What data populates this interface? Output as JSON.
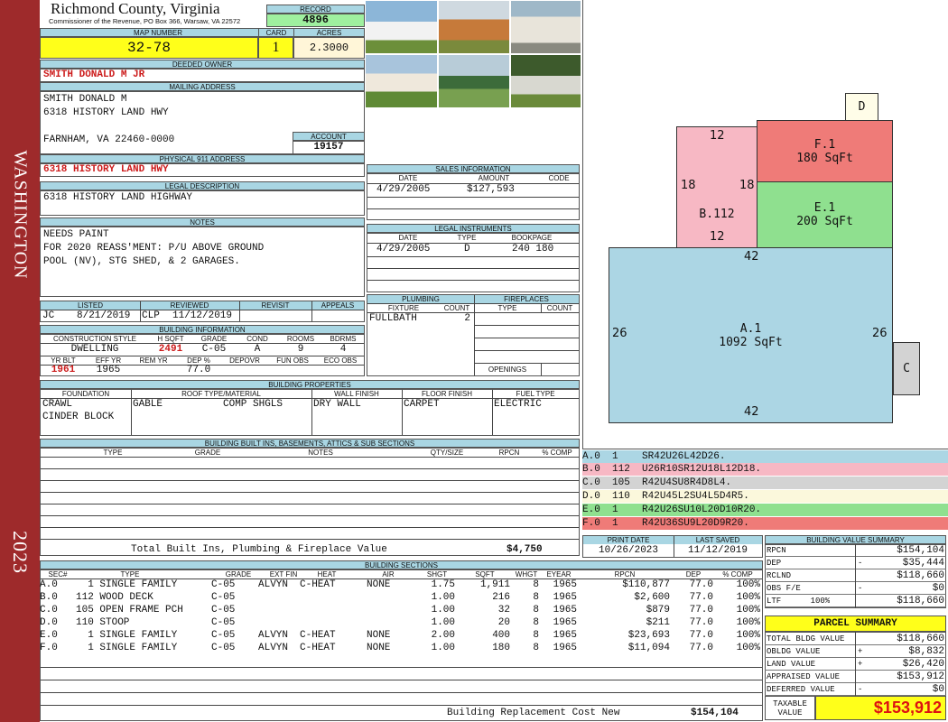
{
  "sidebar": {
    "county": "WASHINGTON",
    "year": "2023"
  },
  "header": {
    "title": "Richmond County, Virginia",
    "subtitle": "Commissioner of the Revenue, PO Box 366, Warsaw, VA 22572",
    "record_label": "RECORD",
    "record": "4896",
    "map_label": "MAP NUMBER",
    "map": "32-78",
    "card_label": "CARD",
    "card": "1",
    "acres_label": "ACRES",
    "acres": "2.3000"
  },
  "owner": {
    "label": "DEEDED OWNER",
    "name": "SMITH DONALD M JR",
    "mail_label": "MAILING ADDRESS",
    "mail1": "SMITH DONALD M",
    "mail2": "6318 HISTORY LAND HWY",
    "mail3": "FARNHAM, VA 22460-0000",
    "account_label": "ACCOUNT",
    "account": "19157",
    "phys_label": "PHYSICAL 911 ADDRESS",
    "phys": "6318 HISTORY LAND HWY",
    "legal_label": "LEGAL DESCRIPTION",
    "legal": "6318 HISTORY LAND HIGHWAY"
  },
  "notes": {
    "label": "NOTES",
    "lines": [
      "NEEDS PAINT",
      "FOR 2020 REASS'MENT: P/U ABOVE GROUND",
      "POOL (NV), STG SHED, & 2 GARAGES."
    ]
  },
  "sales": {
    "label": "SALES INFORMATION",
    "h_date": "DATE",
    "h_amount": "AMOUNT",
    "h_code": "CODE",
    "date": "4/29/2005",
    "amount": "$127,593",
    "code": ""
  },
  "legal_instr": {
    "label": "LEGAL INSTRUMENTS",
    "h_date": "DATE",
    "h_type": "TYPE",
    "h_book": "BOOKPAGE",
    "date": "4/29/2005",
    "type": "D",
    "book": "240 180"
  },
  "review": {
    "h_listed": "LISTED",
    "h_reviewed": "REVIEWED",
    "h_revisit": "REVISIT",
    "h_appeals": "APPEALS",
    "listed_by": "JC",
    "listed": "8/21/2019",
    "reviewed_by": "CLP",
    "reviewed": "11/12/2019"
  },
  "building": {
    "label": "BUILDING INFORMATION",
    "h_style": "CONSTRUCTION STYLE",
    "h_hsqft": "H SQFT",
    "h_grade": "GRADE",
    "h_cond": "COND",
    "h_rooms": "ROOMS",
    "h_bdrms": "BDRMS",
    "style": "DWELLING",
    "hsqft": "2491",
    "grade": "C-05",
    "cond": "A",
    "rooms": "9",
    "bdrms": "4",
    "h_yrblt": "YR BLT",
    "h_effyr": "EFF YR",
    "h_remyr": "REM YR",
    "h_dep": "DEP %",
    "h_depovr": "DEPOVR",
    "h_funobs": "FUN OBS",
    "h_ecoobs": "ECO OBS",
    "yrblt": "1961",
    "effyr": "1965",
    "dep": "77.0"
  },
  "plumbing": {
    "label": "PLUMBING",
    "h_fixture": "FIXTURE",
    "h_count": "COUNT",
    "fixture": "FULLBATH",
    "count": "2"
  },
  "fireplaces": {
    "label": "FIREPLACES",
    "h_type": "TYPE",
    "h_count": "COUNT",
    "openings": "OPENINGS"
  },
  "properties": {
    "label": "BUILDING PROPERTIES",
    "h_found": "FOUNDATION",
    "h_roof": "ROOF TYPE/MATERIAL",
    "h_wall": "WALL FINISH",
    "h_floor": "FLOOR FINISH",
    "h_fuel": "FUEL TYPE",
    "found1": "CRAWL",
    "found2": "CINDER BLOCK",
    "roof1": "GABLE",
    "roof2": "COMP SHGLS",
    "wall": "DRY WALL",
    "floor": "CARPET",
    "fuel": "ELECTRIC"
  },
  "builtins": {
    "label": "BUILDING BUILT INS, BASEMENTS, ATTICS & SUB SECTIONS",
    "h_type": "TYPE",
    "h_grade": "GRADE",
    "h_notes": "NOTES",
    "h_qty": "QTY/SIZE",
    "h_rpcn": "RPCN",
    "h_comp": "% COMP",
    "total_label": "Total Built Ins, Plumbing & Fireplace Value",
    "total": "$4,750"
  },
  "dates": {
    "h_print": "PRINT DATE",
    "h_saved": "LAST SAVED",
    "print": "10/26/2023",
    "saved": "11/12/2019"
  },
  "sketch": {
    "D": "D",
    "C": "C",
    "F_label": "F.1",
    "F_area": "180 SqFt",
    "E_label": "E.1",
    "E_area": "200 SqFt",
    "B_label": "B.112",
    "A_label": "A.1",
    "A_area": "1092 SqFt",
    "d12a": "12",
    "d12b": "12",
    "d18a": "18",
    "d18b": "18",
    "d42a": "42",
    "d42b": "42",
    "d26a": "26",
    "d26b": "26"
  },
  "legend": [
    {
      "text": "A.0  1    SR42U26L42D26.",
      "color": "#acd6e4"
    },
    {
      "text": "B.0  112  U26R10SR12U18L12D18.",
      "color": "#f7b8c4"
    },
    {
      "text": "C.0  105  R42U4SU8R4D8L4.",
      "color": "#d3d3d3"
    },
    {
      "text": "D.0  110  R42U45L2SU4L5D4R5.",
      "color": "#fbf8dc"
    },
    {
      "text": "E.0  1    R42U26SU10L20D10R20.",
      "color": "#8fe08f"
    },
    {
      "text": "F.0  1    R42U36SU9L20D9R20.",
      "color": "#ef7b78"
    }
  ],
  "value_summary": {
    "label": "BUILDING VALUE SUMMARY",
    "rows": [
      {
        "k": "RPCN",
        "s": "",
        "v": "$154,104"
      },
      {
        "k": "DEP",
        "s": "-",
        "v": "$35,444"
      },
      {
        "k": "RCLND",
        "s": "",
        "v": "$118,660"
      },
      {
        "k": "OBS F/E",
        "s": "-",
        "v": "$0"
      },
      {
        "k": "LTF      100%",
        "s": "",
        "v": "$118,660"
      }
    ]
  },
  "parcel": {
    "label": "PARCEL SUMMARY",
    "rows": [
      {
        "k": "TOTAL BLDG VALUE",
        "s": "",
        "v": "$118,660"
      },
      {
        "k": "OBLDG VALUE",
        "s": "+",
        "v": "$8,832"
      },
      {
        "k": "LAND VALUE",
        "s": "+",
        "v": "$26,420"
      },
      {
        "k": "APPRAISED VALUE",
        "s": "",
        "v": "$153,912"
      },
      {
        "k": "DEFERRED VALUE",
        "s": "-",
        "v": "$0"
      }
    ],
    "taxable_label": "TAXABLE VALUE",
    "taxable": "$153,912"
  },
  "sections": {
    "label": "BUILDING SECTIONS",
    "headers": [
      "SEC#",
      "TYPE",
      "GRADE",
      "EXT FIN",
      "HEAT",
      "AIR",
      "SHGT",
      "SQFT",
      "WHGT",
      "EYEAR",
      "RPCN",
      "DEP",
      "% COMP"
    ],
    "rows": [
      [
        "A.0",
        "1 SINGLE FAMILY",
        "C-05",
        "ALVYN",
        "C-HEAT",
        "NONE",
        "1.75",
        "1,911",
        "8",
        "1965",
        "$110,877",
        "77.0",
        "100%"
      ],
      [
        "B.0",
        "112 WOOD DECK",
        "C-05",
        "",
        "",
        "",
        "1.00",
        "216",
        "8",
        "1965",
        "$2,600",
        "77.0",
        "100%"
      ],
      [
        "C.0",
        "105 OPEN FRAME PCH",
        "C-05",
        "",
        "",
        "",
        "1.00",
        "32",
        "8",
        "1965",
        "$879",
        "77.0",
        "100%"
      ],
      [
        "D.0",
        "110 STOOP",
        "C-05",
        "",
        "",
        "",
        "1.00",
        "20",
        "8",
        "1965",
        "$211",
        "77.0",
        "100%"
      ],
      [
        "E.0",
        "1 SINGLE FAMILY",
        "C-05",
        "ALVYN",
        "C-HEAT",
        "NONE",
        "2.00",
        "400",
        "8",
        "1965",
        "$23,693",
        "77.0",
        "100%"
      ],
      [
        "F.0",
        "1 SINGLE FAMILY",
        "C-05",
        "ALVYN",
        "C-HEAT",
        "NONE",
        "1.00",
        "180",
        "8",
        "1965",
        "$11,094",
        "77.0",
        "100%"
      ]
    ],
    "total_label": "Building Replacement Cost New",
    "total": "$154,104"
  }
}
